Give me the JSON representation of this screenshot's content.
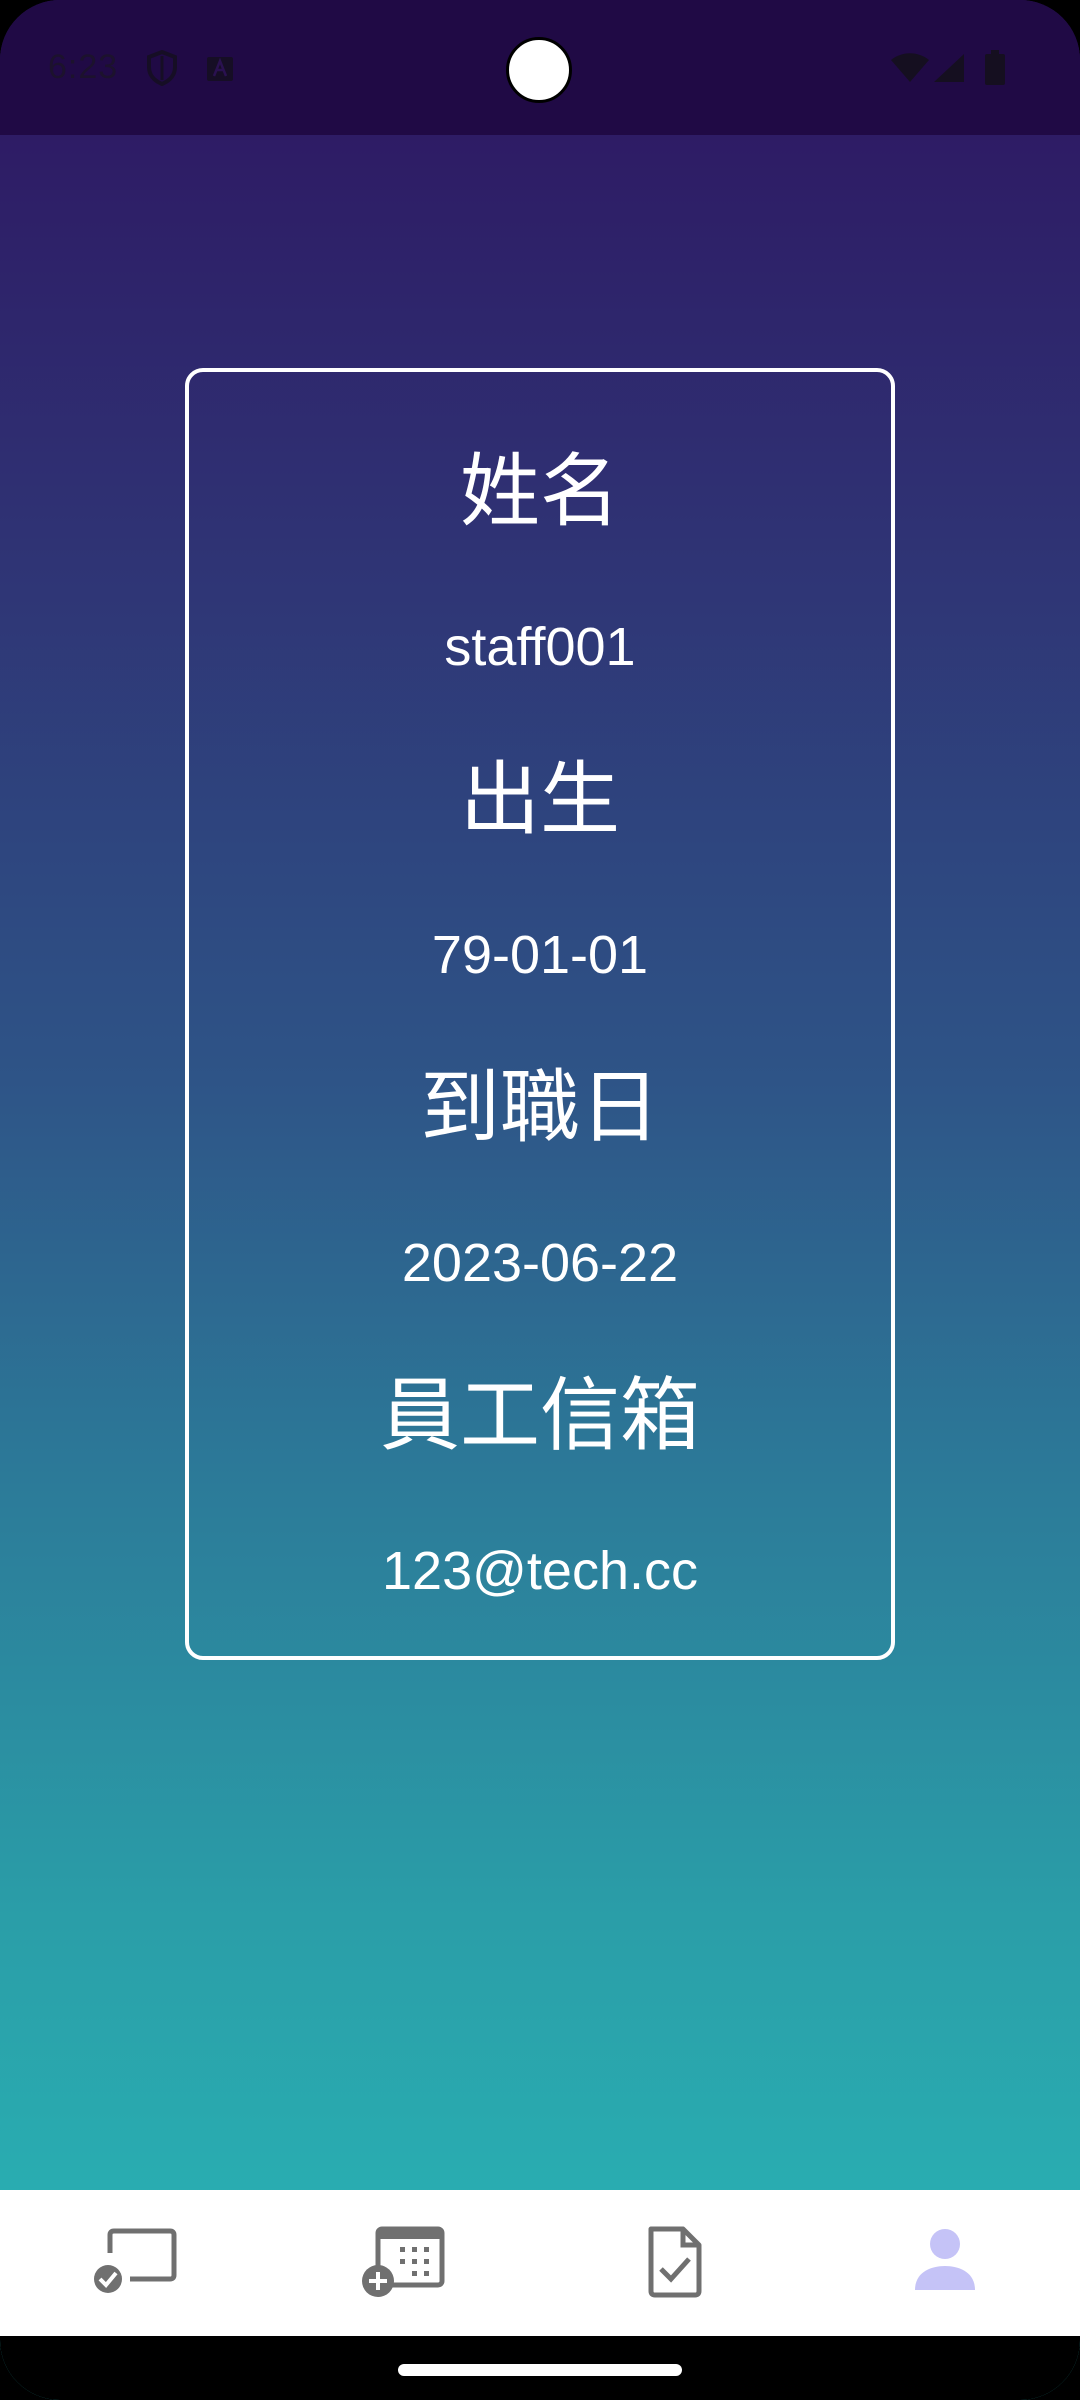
{
  "status_bar": {
    "time": "6:23",
    "icons": [
      "shield-icon",
      "keyboard-a-icon",
      "wifi-icon",
      "signal-icon",
      "battery-icon"
    ]
  },
  "profile": {
    "name_label": "姓名",
    "name_value": "staff001",
    "birth_label": "出生",
    "birth_value": "79-01-01",
    "hire_label": "到職日",
    "hire_value": "2023-06-22",
    "email_label": "員工信箱",
    "email_value": "123@tech.cc"
  },
  "bottom_nav": {
    "items": [
      {
        "icon": "check-in-icon",
        "active": false
      },
      {
        "icon": "add-calendar-icon",
        "active": false
      },
      {
        "icon": "approved-document-icon",
        "active": false
      },
      {
        "icon": "person-icon",
        "active": true
      }
    ],
    "active_color": "#c5c3f7",
    "inactive_color": "#707070"
  },
  "colors": {
    "status_bar": "#200a45",
    "gradient_top": "#2d1460",
    "gradient_bottom": "#28b8b8"
  }
}
